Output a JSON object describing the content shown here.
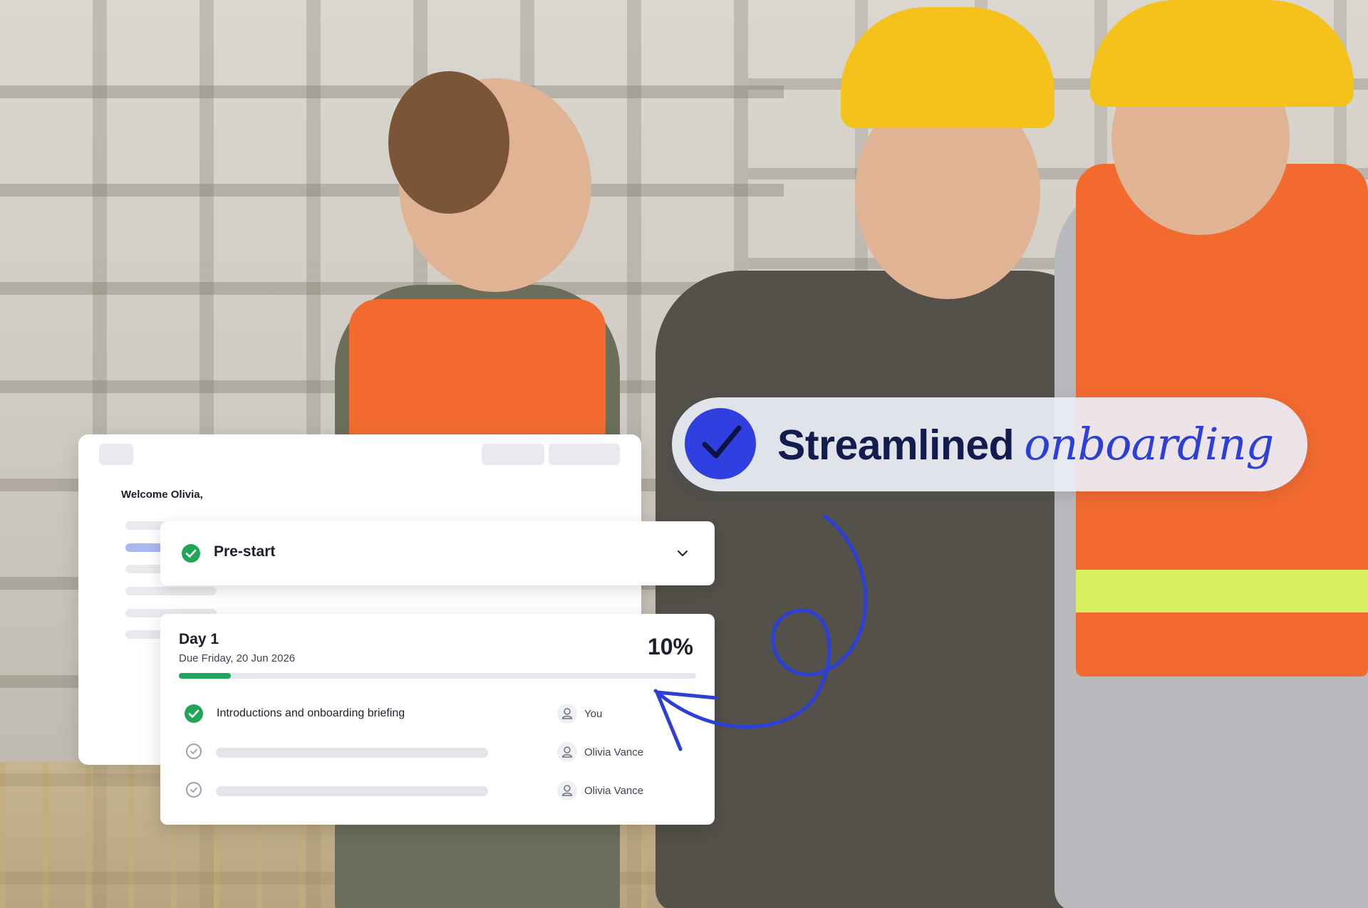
{
  "badge": {
    "title": "Streamlined",
    "script_word": "onboarding",
    "accent_color": "#2f3fe0",
    "icon": "check-circle-icon"
  },
  "back_card": {
    "greeting": "Welcome Olivia,"
  },
  "prestart": {
    "label": "Pre-start",
    "status_icon": "check-circle-icon",
    "expand_icon": "chevron-down-icon"
  },
  "day": {
    "title": "Day 1",
    "due": "Due Friday, 20 Jun 2026",
    "percent_label": "10%",
    "progress": 0.1,
    "progress_color": "#1fa659",
    "tasks": [
      {
        "label": "Introductions and onboarding briefing",
        "done": true,
        "assignee": "You"
      },
      {
        "label": "",
        "done": false,
        "assignee": "Olivia Vance"
      },
      {
        "label": "",
        "done": false,
        "assignee": "Olivia Vance"
      }
    ]
  }
}
